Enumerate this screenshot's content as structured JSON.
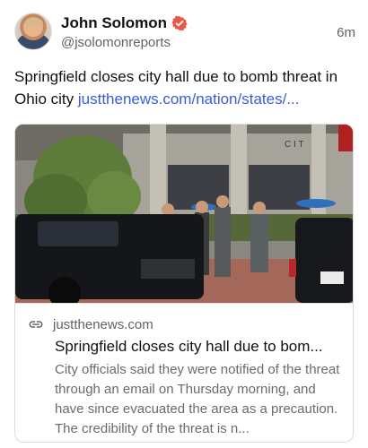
{
  "author": {
    "display_name": "John Solomon",
    "handle": "@jsolomonreports",
    "verified_icon": "verified-badge-icon",
    "avatar_icon": "avatar"
  },
  "timestamp": "6m",
  "post": {
    "text": "Springfield closes city hall due to bomb threat in Ohio city ",
    "link_text": "justthenews.com/nation/states/..."
  },
  "card": {
    "domain": "justthenews.com",
    "title": "Springfield closes city hall due to bom...",
    "description": "City officials said they were notified of the threat through an email on Thursday morning, and have since evacuated the area as a precaution. The credibility of the threat is n...",
    "image_sign_text": "C I T",
    "link_icon": "link-icon"
  },
  "colors": {
    "link": "#3b5bdb",
    "verified": "#e8594a",
    "muted": "#5f6368"
  }
}
